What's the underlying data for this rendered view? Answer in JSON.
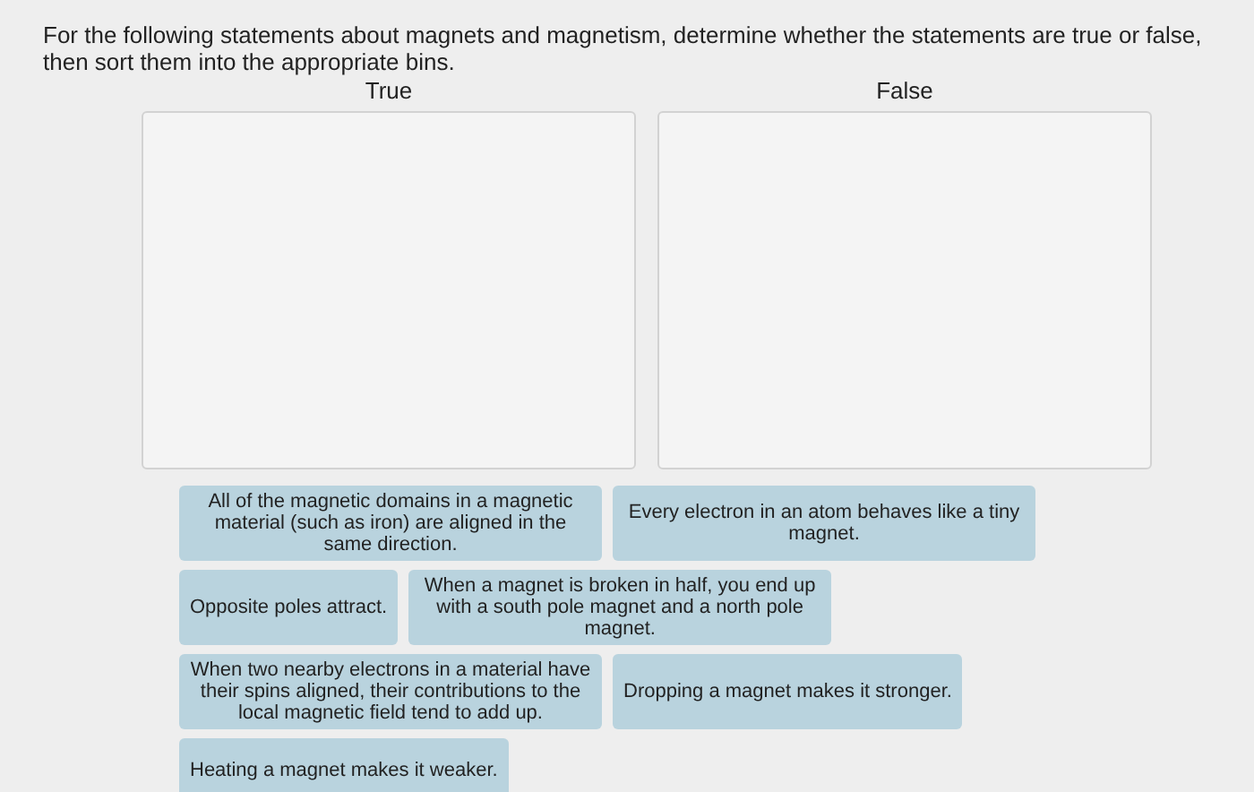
{
  "instructions": "For the following statements about magnets and magnetism, determine whether the statements are true or false, then sort them into the appropriate bins.",
  "bins": [
    {
      "label": "True"
    },
    {
      "label": "False"
    }
  ],
  "cards": [
    {
      "text": "All of the magnetic domains in a magnetic material (such as iron) are aligned in the same direction."
    },
    {
      "text": "Every electron in an atom behaves like a tiny magnet."
    },
    {
      "text": "Opposite poles attract."
    },
    {
      "text": "When a magnet is broken in half, you end up with a south pole magnet and a north pole magnet."
    },
    {
      "text": "When two nearby electrons in a material have their spins aligned, their contributions to the local magnetic field tend to add up."
    },
    {
      "text": "Dropping a magnet makes it stronger."
    },
    {
      "text": "Heating a magnet makes it weaker."
    }
  ]
}
